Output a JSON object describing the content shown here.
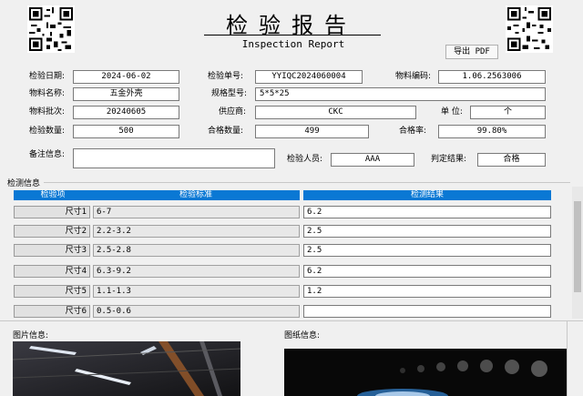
{
  "header": {
    "title": "检验报告",
    "subtitle": "Inspection Report",
    "export_pdf": "导出 PDF"
  },
  "info": {
    "inspection_date": {
      "label": "检验日期:",
      "value": "2024-06-02"
    },
    "inspection_no": {
      "label": "检验单号:",
      "value": "YYIQC2024060004"
    },
    "material_code": {
      "label": "物料编码:",
      "value": "1.06.2563006"
    },
    "material_name": {
      "label": "物料名称:",
      "value": "五金外壳"
    },
    "spec_model": {
      "label": "规格型号:",
      "value": "5*5*25"
    },
    "material_batch": {
      "label": "物料批次:",
      "value": "20240605"
    },
    "supplier": {
      "label": "供应商:",
      "value": "CKC"
    },
    "unit": {
      "label": "单 位:",
      "value": "个"
    },
    "inspect_qty": {
      "label": "检验数量:",
      "value": "500"
    },
    "pass_qty": {
      "label": "合格数量:",
      "value": "499"
    },
    "pass_rate": {
      "label": "合格率:",
      "value": "99.80%"
    },
    "remark": {
      "label": "备注信息:",
      "value": ""
    },
    "inspector": {
      "label": "检验人员:",
      "value": "AAA"
    },
    "judgement": {
      "label": "判定结果:",
      "value": "合格"
    }
  },
  "detection": {
    "section_title": "检测信息",
    "columns": [
      "检验项",
      "检验标准",
      "检测结果"
    ],
    "rows": [
      {
        "item": "尺寸1",
        "standard": "6-7",
        "result": "6.2"
      },
      {
        "item": "尺寸2",
        "standard": "2.2-3.2",
        "result": "2.5"
      },
      {
        "item": "尺寸3",
        "standard": "2.5-2.8",
        "result": "2.5"
      },
      {
        "item": "尺寸4",
        "standard": "6.3-9.2",
        "result": "6.2"
      },
      {
        "item": "尺寸5",
        "standard": "1.1-1.3",
        "result": "1.2"
      },
      {
        "item": "尺寸6",
        "standard": "0.5-0.6",
        "result": ""
      }
    ]
  },
  "images": {
    "picture_label": "图片信息:",
    "drawing_label": "图纸信息:"
  },
  "colors": {
    "accent": "#0a78d4",
    "background": "#f0f0f0"
  }
}
